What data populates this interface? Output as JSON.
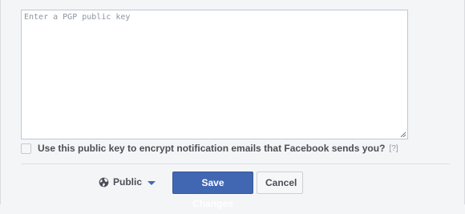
{
  "pgp_form": {
    "key_textarea": {
      "placeholder": "Enter a PGP public key",
      "value": ""
    },
    "encrypt_checkbox": {
      "checked": false,
      "label": "Use this public key to encrypt notification emails that Facebook sends you?",
      "help": "[?]"
    }
  },
  "footer": {
    "audience": {
      "icon": "globe-icon",
      "label": "Public",
      "dropdown_icon": "caret-down-icon"
    },
    "save_label": "Save Changes",
    "cancel_label": "Cancel"
  },
  "colors": {
    "primary_button": "#4267b2",
    "primary_border": "#365899",
    "text_dark": "#4b4f56",
    "help_gray": "#9197a3",
    "background": "#f4f5f7"
  }
}
